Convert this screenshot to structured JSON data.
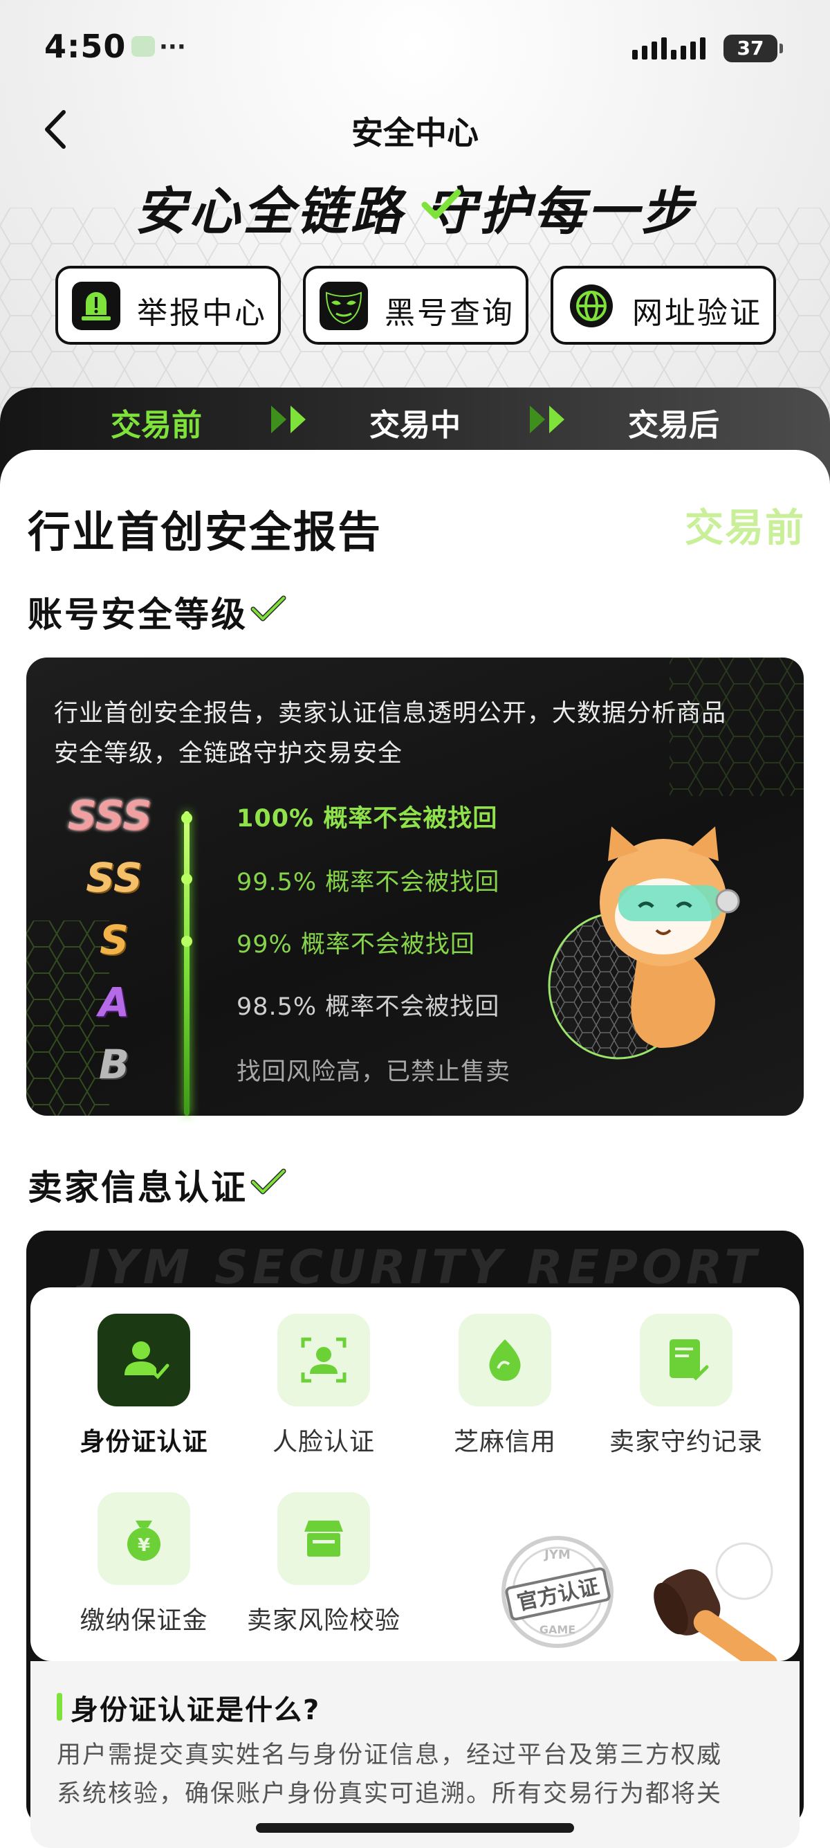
{
  "status_bar": {
    "time": "4:50",
    "dots": "···",
    "battery": "37"
  },
  "nav": {
    "title": "安全中心",
    "back_icon": "chevron-left-icon"
  },
  "hero": {
    "slogan": "安心全链路  守护每一步"
  },
  "quick_actions": [
    {
      "label": "举报中心",
      "icon": "alarm-siren-icon"
    },
    {
      "label": "黑号查询",
      "icon": "mask-icon"
    },
    {
      "label": "网址验证",
      "icon": "globe-icon"
    }
  ],
  "stages": {
    "items": [
      "交易前",
      "交易中",
      "交易后"
    ],
    "active": 0,
    "active_color": "#7ee23b"
  },
  "report": {
    "title": "行业首创安全报告",
    "stage_watermark": "交易前"
  },
  "account_level": {
    "title": "账号安全等级",
    "description_line1": "行业首创安全报告，卖家认证信息透明公开，大数据分析商品",
    "description_line2": "安全等级，全链路守护交易安全",
    "levels": [
      {
        "grade": "SSS",
        "text": "100% 概率不会被找回"
      },
      {
        "grade": "SS",
        "text": "99.5% 概率不会被找回"
      },
      {
        "grade": "S",
        "text": "99% 概率不会被找回"
      },
      {
        "grade": "A",
        "text": "98.5% 概率不会被找回"
      },
      {
        "grade": "B",
        "text": "找回风险高，已禁止售卖"
      }
    ]
  },
  "seller_info": {
    "title": "卖家信息认证",
    "watermark": "JYM SECURITY REPORT",
    "features": [
      {
        "label": "身份证认证",
        "icon": "id-user-check-icon",
        "active": true
      },
      {
        "label": "人脸认证",
        "icon": "face-scan-icon",
        "active": false
      },
      {
        "label": "芝麻信用",
        "icon": "sesame-credit-icon",
        "active": false
      },
      {
        "label": "卖家守约记录",
        "icon": "document-check-icon",
        "active": false
      },
      {
        "label": "缴纳保证金",
        "icon": "money-bag-icon",
        "active": false
      },
      {
        "label": "卖家风险校验",
        "icon": "storefront-icon",
        "active": false
      }
    ],
    "seal": {
      "top": "JYM",
      "main": "官方认证",
      "bottom": "GAME"
    }
  },
  "explainer": {
    "title": "身份证认证是什么?",
    "body_line1": "用户需提交真实姓名与身份证信息，经过平台及第三方权威",
    "body_line2": "系统核验，确保账户身份真实可追溯。所有交易行为都将关"
  },
  "colors": {
    "accent_green": "#7ee23b",
    "dark": "#121212",
    "grade_sss": "#f0a0a0",
    "grade_ss": "#f5c06a",
    "grade_s": "#f1b34a",
    "grade_a": "#b56ae8",
    "grade_b": "#b8b8b8"
  }
}
